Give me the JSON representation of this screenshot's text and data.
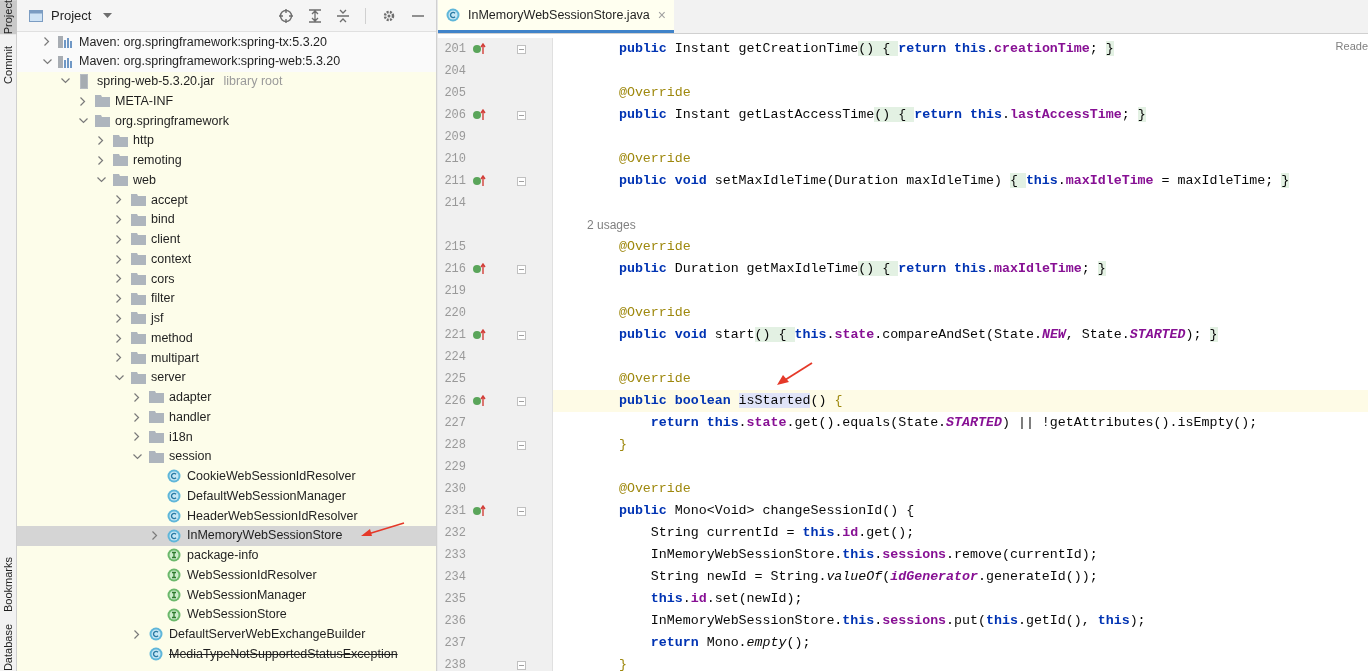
{
  "tool_strip": {
    "top": [
      {
        "label": "Project",
        "selected": true
      },
      {
        "label": "Commit",
        "selected": false
      }
    ],
    "bottom": [
      {
        "label": "Bookmarks",
        "selected": false
      },
      {
        "label": "Database",
        "selected": false
      }
    ]
  },
  "project_panel": {
    "title": "Project"
  },
  "tree": [
    {
      "kind": "library",
      "label": "Maven: org.springframework:spring-tx:5.3.20",
      "expanded": false,
      "selected": false
    },
    {
      "kind": "library",
      "label": "Maven: org.springframework:spring-web:5.3.20",
      "expanded": true,
      "selected": false,
      "children": [
        {
          "kind": "jar",
          "label": "spring-web-5.3.20.jar",
          "hint": "library root",
          "expanded": true,
          "selected": false,
          "children": [
            {
              "kind": "folder",
              "label": "META-INF",
              "expanded": false,
              "selected": false
            },
            {
              "kind": "folder",
              "label": "org.springframework",
              "expanded": true,
              "selected": false,
              "children": [
                {
                  "kind": "folder",
                  "label": "http",
                  "expanded": false,
                  "selected": false
                },
                {
                  "kind": "folder",
                  "label": "remoting",
                  "expanded": false,
                  "selected": false
                },
                {
                  "kind": "folder",
                  "label": "web",
                  "expanded": true,
                  "selected": false,
                  "children": [
                    {
                      "kind": "folder",
                      "label": "accept",
                      "expanded": false,
                      "selected": false
                    },
                    {
                      "kind": "folder",
                      "label": "bind",
                      "expanded": false,
                      "selected": false
                    },
                    {
                      "kind": "folder",
                      "label": "client",
                      "expanded": false,
                      "selected": false
                    },
                    {
                      "kind": "folder",
                      "label": "context",
                      "expanded": false,
                      "selected": false
                    },
                    {
                      "kind": "folder",
                      "label": "cors",
                      "expanded": false,
                      "selected": false
                    },
                    {
                      "kind": "folder",
                      "label": "filter",
                      "expanded": false,
                      "selected": false
                    },
                    {
                      "kind": "folder",
                      "label": "jsf",
                      "expanded": false,
                      "selected": false
                    },
                    {
                      "kind": "folder",
                      "label": "method",
                      "expanded": false,
                      "selected": false
                    },
                    {
                      "kind": "folder",
                      "label": "multipart",
                      "expanded": false,
                      "selected": false
                    },
                    {
                      "kind": "folder",
                      "label": "server",
                      "expanded": true,
                      "selected": false,
                      "children": [
                        {
                          "kind": "folder",
                          "label": "adapter",
                          "expanded": false,
                          "selected": false,
                          "deprecated": false
                        },
                        {
                          "kind": "folder",
                          "label": "handler",
                          "expanded": false,
                          "selected": false,
                          "deprecated": false
                        },
                        {
                          "kind": "folder",
                          "label": "i18n",
                          "expanded": false,
                          "selected": false,
                          "deprecated": false
                        },
                        {
                          "kind": "folder",
                          "label": "session",
                          "expanded": true,
                          "selected": false,
                          "deprecated": false,
                          "children": [
                            {
                              "kind": "class",
                              "label": "CookieWebSessionIdResolver",
                              "selected": false
                            },
                            {
                              "kind": "class",
                              "label": "DefaultWebSessionManager",
                              "selected": false
                            },
                            {
                              "kind": "class",
                              "label": "HeaderWebSessionIdResolver",
                              "selected": false
                            },
                            {
                              "kind": "class",
                              "label": "InMemoryWebSessionStore",
                              "expanded": false,
                              "selected": true
                            },
                            {
                              "kind": "interface",
                              "label": "package-info",
                              "selected": false
                            },
                            {
                              "kind": "interface",
                              "label": "WebSessionIdResolver",
                              "selected": false
                            },
                            {
                              "kind": "interface",
                              "label": "WebSessionManager",
                              "selected": false
                            },
                            {
                              "kind": "interface",
                              "label": "WebSessionStore",
                              "selected": false
                            }
                          ]
                        },
                        {
                          "kind": "class",
                          "label": "DefaultServerWebExchangeBuilder",
                          "expanded": false,
                          "selected": false,
                          "deprecated": false
                        },
                        {
                          "kind": "class",
                          "label": "MediaTypeNotSupportedStatusException",
                          "selected": false,
                          "deprecated": true
                        }
                      ]
                    }
                  ]
                }
              ]
            }
          ]
        }
      ]
    }
  ],
  "editor": {
    "tabs": [
      {
        "label": "InMemoryWebSessionStore.java",
        "selected": true,
        "close": "×"
      }
    ],
    "reader_mode": "Reade",
    "lines": [
      {
        "number": "201",
        "marker": true,
        "fold": true,
        "current": false,
        "tokens": [
          {
            "kind": "kw",
            "text": "    public"
          },
          {
            "kind": "p",
            "text": " Instant getCreationTime"
          },
          {
            "kind": "fold",
            "text": "() "
          },
          {
            "kind": "fold",
            "text": "{ "
          },
          {
            "kind": "kw",
            "text": "return this"
          },
          {
            "kind": "p",
            "text": "."
          },
          {
            "kind": "field",
            "text": "creationTime"
          },
          {
            "kind": "p",
            "text": "; "
          },
          {
            "kind": "fold",
            "text": "}"
          }
        ]
      },
      {
        "number": "204",
        "marker": false,
        "fold": false
      },
      {
        "number": "205",
        "marker": false,
        "fold": false,
        "current": false,
        "tokens": [
          {
            "kind": "ann",
            "text": "    @Override"
          }
        ]
      },
      {
        "number": "206",
        "marker": true,
        "fold": true,
        "current": false,
        "tokens": [
          {
            "kind": "kw",
            "text": "    public"
          },
          {
            "kind": "p",
            "text": " Instant getLastAccessTime"
          },
          {
            "kind": "fold",
            "text": "() "
          },
          {
            "kind": "fold",
            "text": "{ "
          },
          {
            "kind": "kw",
            "text": "return this"
          },
          {
            "kind": "p",
            "text": "."
          },
          {
            "kind": "field",
            "text": "lastAccessTime"
          },
          {
            "kind": "p",
            "text": "; "
          },
          {
            "kind": "fold",
            "text": "}"
          }
        ]
      },
      {
        "number": "209",
        "marker": false,
        "fold": false
      },
      {
        "number": "210",
        "marker": false,
        "fold": false,
        "current": false,
        "tokens": [
          {
            "kind": "ann",
            "text": "    @Override"
          }
        ]
      },
      {
        "number": "211",
        "marker": true,
        "fold": true,
        "current": false,
        "tokens": [
          {
            "kind": "kw",
            "text": "    public void"
          },
          {
            "kind": "p",
            "text": " setMaxIdleTime(Duration maxIdleTime) "
          },
          {
            "kind": "fold",
            "text": "{ "
          },
          {
            "kind": "kw",
            "text": "this"
          },
          {
            "kind": "p",
            "text": "."
          },
          {
            "kind": "field",
            "text": "maxIdleTime"
          },
          {
            "kind": "p",
            "text": " = maxIdleTime; "
          },
          {
            "kind": "fold",
            "text": "}"
          }
        ]
      },
      {
        "number": "214",
        "marker": false,
        "fold": false
      },
      {
        "kind": "hint",
        "text": "2 usages"
      },
      {
        "number": "215",
        "marker": false,
        "fold": false,
        "current": false,
        "tokens": [
          {
            "kind": "ann",
            "text": "    @Override"
          }
        ]
      },
      {
        "number": "216",
        "marker": true,
        "fold": true,
        "current": false,
        "tokens": [
          {
            "kind": "kw",
            "text": "    public"
          },
          {
            "kind": "p",
            "text": " Duration getMaxIdleTime"
          },
          {
            "kind": "fold",
            "text": "() "
          },
          {
            "kind": "fold",
            "text": "{ "
          },
          {
            "kind": "kw",
            "text": "return this"
          },
          {
            "kind": "p",
            "text": "."
          },
          {
            "kind": "field",
            "text": "maxIdleTime"
          },
          {
            "kind": "p",
            "text": "; "
          },
          {
            "kind": "fold",
            "text": "}"
          }
        ]
      },
      {
        "number": "219",
        "marker": false,
        "fold": false
      },
      {
        "number": "220",
        "marker": false,
        "fold": false,
        "current": false,
        "tokens": [
          {
            "kind": "ann",
            "text": "    @Override"
          }
        ]
      },
      {
        "number": "221",
        "marker": true,
        "fold": true,
        "current": false,
        "tokens": [
          {
            "kind": "kw",
            "text": "    public void"
          },
          {
            "kind": "p",
            "text": " start"
          },
          {
            "kind": "fold",
            "text": "() "
          },
          {
            "kind": "fold",
            "text": "{ "
          },
          {
            "kind": "kw",
            "text": "this"
          },
          {
            "kind": "p",
            "text": "."
          },
          {
            "kind": "field",
            "text": "state"
          },
          {
            "kind": "p",
            "text": ".compareAndSet(State."
          },
          {
            "kind": "sfield",
            "text": "NEW"
          },
          {
            "kind": "p",
            "text": ", State."
          },
          {
            "kind": "sfield",
            "text": "STARTED"
          },
          {
            "kind": "p",
            "text": "); "
          },
          {
            "kind": "fold",
            "text": "}"
          }
        ]
      },
      {
        "number": "224",
        "marker": false,
        "fold": false
      },
      {
        "number": "225",
        "marker": false,
        "fold": false,
        "current": false,
        "tokens": [
          {
            "kind": "ann",
            "text": "    @Override"
          }
        ]
      },
      {
        "number": "226",
        "marker": true,
        "fold": true,
        "current": true,
        "tokens": [
          {
            "kind": "kw",
            "text": "    public boolean "
          },
          {
            "kind": "mark",
            "text": "isStarted"
          },
          {
            "kind": "p",
            "text": "() "
          },
          {
            "kind": "brace",
            "text": "{"
          }
        ]
      },
      {
        "number": "227",
        "marker": false,
        "fold": false,
        "current": false,
        "tokens": [
          {
            "kind": "kw",
            "text": "        return this"
          },
          {
            "kind": "p",
            "text": "."
          },
          {
            "kind": "field",
            "text": "state"
          },
          {
            "kind": "p",
            "text": ".get().equals(State."
          },
          {
            "kind": "sfield",
            "text": "STARTED"
          },
          {
            "kind": "p",
            "text": ") || !getAttributes().isEmpty();"
          }
        ]
      },
      {
        "number": "228",
        "marker": false,
        "fold": true,
        "current": false,
        "tokens": [
          {
            "kind": "brace",
            "text": "    }"
          }
        ]
      },
      {
        "number": "229",
        "marker": false,
        "fold": false
      },
      {
        "number": "230",
        "marker": false,
        "fold": false,
        "current": false,
        "tokens": [
          {
            "kind": "ann",
            "text": "    @Override"
          }
        ]
      },
      {
        "number": "231",
        "marker": true,
        "fold": true,
        "current": false,
        "tokens": [
          {
            "kind": "kw",
            "text": "    public"
          },
          {
            "kind": "p",
            "text": " Mono<Void> changeSessionId() {"
          }
        ]
      },
      {
        "number": "232",
        "marker": false,
        "fold": false,
        "current": false,
        "tokens": [
          {
            "kind": "p",
            "text": "        String currentId = "
          },
          {
            "kind": "kw",
            "text": "this"
          },
          {
            "kind": "p",
            "text": "."
          },
          {
            "kind": "field",
            "text": "id"
          },
          {
            "kind": "p",
            "text": ".get();"
          }
        ]
      },
      {
        "number": "233",
        "marker": false,
        "fold": false,
        "current": false,
        "tokens": [
          {
            "kind": "p",
            "text": "        InMemoryWebSessionStore."
          },
          {
            "kind": "kw",
            "text": "this"
          },
          {
            "kind": "p",
            "text": "."
          },
          {
            "kind": "field",
            "text": "sessions"
          },
          {
            "kind": "p",
            "text": ".remove(currentId);"
          }
        ]
      },
      {
        "number": "234",
        "marker": false,
        "fold": false,
        "current": false,
        "tokens": [
          {
            "kind": "p",
            "text": "        String newId = String."
          },
          {
            "kind": "static",
            "text": "valueOf"
          },
          {
            "kind": "p",
            "text": "("
          },
          {
            "kind": "sfield",
            "text": "idGenerator"
          },
          {
            "kind": "p",
            "text": ".generateId());"
          }
        ]
      },
      {
        "number": "235",
        "marker": false,
        "fold": false,
        "current": false,
        "tokens": [
          {
            "kind": "kw",
            "text": "        this"
          },
          {
            "kind": "p",
            "text": "."
          },
          {
            "kind": "field",
            "text": "id"
          },
          {
            "kind": "p",
            "text": ".set(newId);"
          }
        ]
      },
      {
        "number": "236",
        "marker": false,
        "fold": false,
        "current": false,
        "tokens": [
          {
            "kind": "p",
            "text": "        InMemoryWebSessionStore."
          },
          {
            "kind": "kw",
            "text": "this"
          },
          {
            "kind": "p",
            "text": "."
          },
          {
            "kind": "field",
            "text": "sessions"
          },
          {
            "kind": "p",
            "text": ".put("
          },
          {
            "kind": "kw",
            "text": "this"
          },
          {
            "kind": "p",
            "text": ".getId(), "
          },
          {
            "kind": "kw",
            "text": "this"
          },
          {
            "kind": "p",
            "text": ");"
          }
        ]
      },
      {
        "number": "237",
        "marker": false,
        "fold": false,
        "current": false,
        "tokens": [
          {
            "kind": "kw",
            "text": "        return"
          },
          {
            "kind": "p",
            "text": " Mono."
          },
          {
            "kind": "static",
            "text": "empty"
          },
          {
            "kind": "p",
            "text": "();"
          }
        ]
      },
      {
        "number": "238",
        "marker": false,
        "fold": true,
        "current": false,
        "tokens": [
          {
            "kind": "brace",
            "text": "    }"
          }
        ]
      }
    ]
  }
}
